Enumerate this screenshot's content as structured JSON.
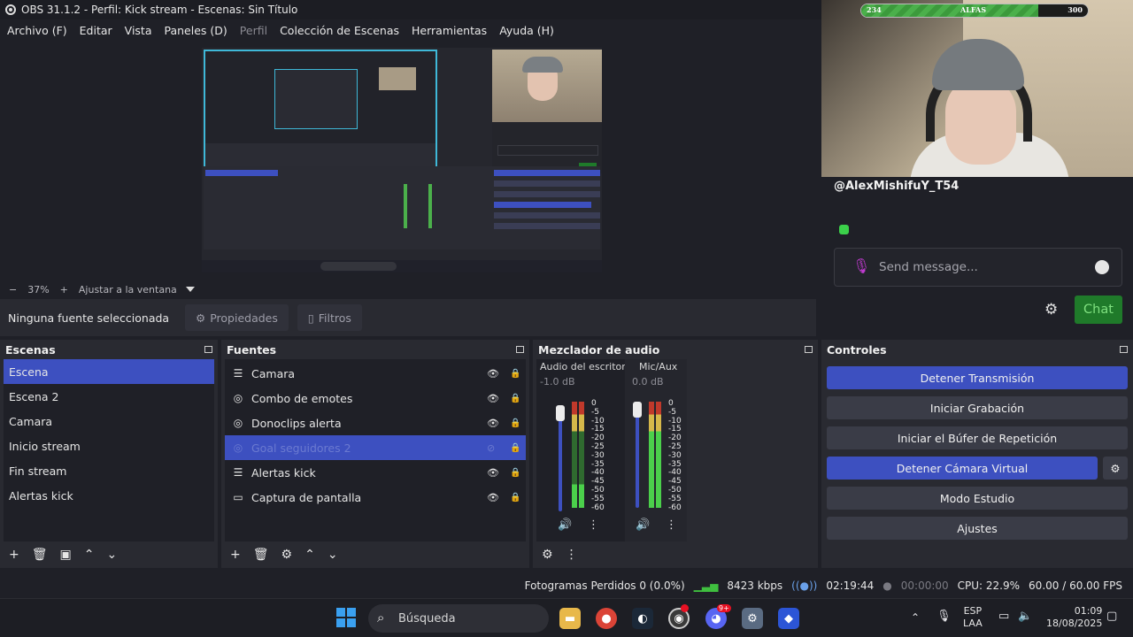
{
  "window": {
    "title": "OBS 31.1.2 - Perfil: Kick stream - Escenas: Sin Título"
  },
  "menu": [
    {
      "label": "Archivo (F)",
      "disabled": false
    },
    {
      "label": "Editar",
      "disabled": false
    },
    {
      "label": "Vista",
      "disabled": false
    },
    {
      "label": "Paneles (D)",
      "disabled": false
    },
    {
      "label": "Perfil",
      "disabled": true
    },
    {
      "label": "Colección de Escenas",
      "disabled": false
    },
    {
      "label": "Herramientas",
      "disabled": false
    },
    {
      "label": "Ayuda (H)",
      "disabled": false
    }
  ],
  "preview_bar": {
    "minus": "−",
    "zoom": "37%",
    "plus": "+",
    "fit": "Ajustar a la ventana"
  },
  "source_bar": {
    "none_selected": "Ninguna fuente seleccionada",
    "properties": "Propiedades",
    "filters": "Filtros"
  },
  "scenes": {
    "title": "Escenas",
    "items": [
      "Escena",
      "Escena 2",
      "Camara",
      "Inicio stream",
      "Fin stream",
      "Alertas kick"
    ],
    "selected_index": 0
  },
  "sources": {
    "title": "Fuentes",
    "items": [
      {
        "label": "Camara",
        "icon": "list-icon",
        "visible": true
      },
      {
        "label": "Combo de emotes",
        "icon": "globe-icon",
        "visible": true
      },
      {
        "label": "Donoclips alerta",
        "icon": "globe-icon",
        "visible": true
      },
      {
        "label": "Goal seguidores 2",
        "icon": "globe-icon",
        "visible": false
      },
      {
        "label": "Alertas kick",
        "icon": "list-icon",
        "visible": true
      },
      {
        "label": "Captura de pantalla",
        "icon": "monitor-icon",
        "visible": true
      }
    ],
    "selected_index": 3
  },
  "mixer": {
    "title": "Mezclador de audio",
    "channels": [
      {
        "name": "Audio del escritorio",
        "db": "-1.0 dB"
      },
      {
        "name": "Mic/Aux",
        "db": "0.0 dB"
      }
    ],
    "scale": [
      "0",
      "-5",
      "-10",
      "-15",
      "-20",
      "-25",
      "-30",
      "-35",
      "-40",
      "-45",
      "-50",
      "-55",
      "-60"
    ]
  },
  "controls": {
    "title": "Controles",
    "buttons": [
      {
        "label": "Detener Transmisión",
        "active": true
      },
      {
        "label": "Iniciar Grabación",
        "active": false
      },
      {
        "label": "Iniciar el Búfer de Repetición",
        "active": false
      },
      {
        "label": "Detener Cámara Virtual",
        "active": true
      },
      {
        "label": "Modo Estudio",
        "active": false
      },
      {
        "label": "Ajustes",
        "active": false
      }
    ]
  },
  "overlay": {
    "xp_left": "234",
    "xp_center": "ALFAS",
    "xp_right": "300",
    "xp_progress": 0.78,
    "username": "@AlexMishifuY_T54",
    "placeholder": "Send message...",
    "chat_button": "Chat"
  },
  "status": {
    "dropped": "Fotogramas Perdidos 0 (0.0%)",
    "bitrate": "8423 kbps",
    "stream_time": "02:19:44",
    "rec_time": "00:00:00",
    "cpu": "CPU: 22.9%",
    "fps": "60.00 / 60.00 FPS"
  },
  "taskbar": {
    "search": "Búsqueda",
    "lang_top": "ESP",
    "lang_bottom": "LAA",
    "time": "01:09",
    "date": "18/08/2025",
    "discord_badge": "9+"
  },
  "colors": {
    "accent": "#3d50c0",
    "panel": "#292a31",
    "bg": "#1f2027",
    "preview_border": "#3fb8d8"
  }
}
